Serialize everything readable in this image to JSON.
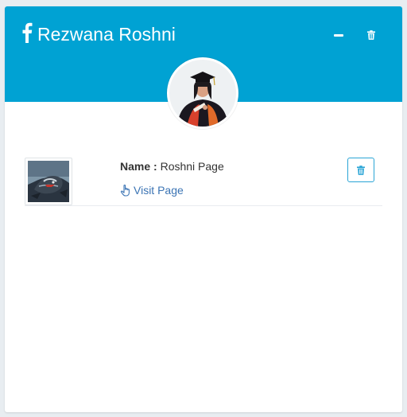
{
  "header": {
    "title": "Rezwana Roshni",
    "icon": "facebook-icon",
    "actions": [
      "minimize-icon",
      "trash-icon"
    ],
    "background_color": "#00a2d3"
  },
  "profile": {
    "avatar": "graduation-photo"
  },
  "pages": [
    {
      "name_key": "Name :",
      "name_value": "Roshni Page",
      "visit_label": "Visit Page",
      "visit_icon": "hand-pointer-icon",
      "delete_icon": "trash-icon",
      "thumbnail": "bird-artwork"
    }
  ],
  "colors": {
    "accent": "#00a2d3",
    "link": "#3b74b4",
    "delete_border": "#2aa5d6"
  }
}
